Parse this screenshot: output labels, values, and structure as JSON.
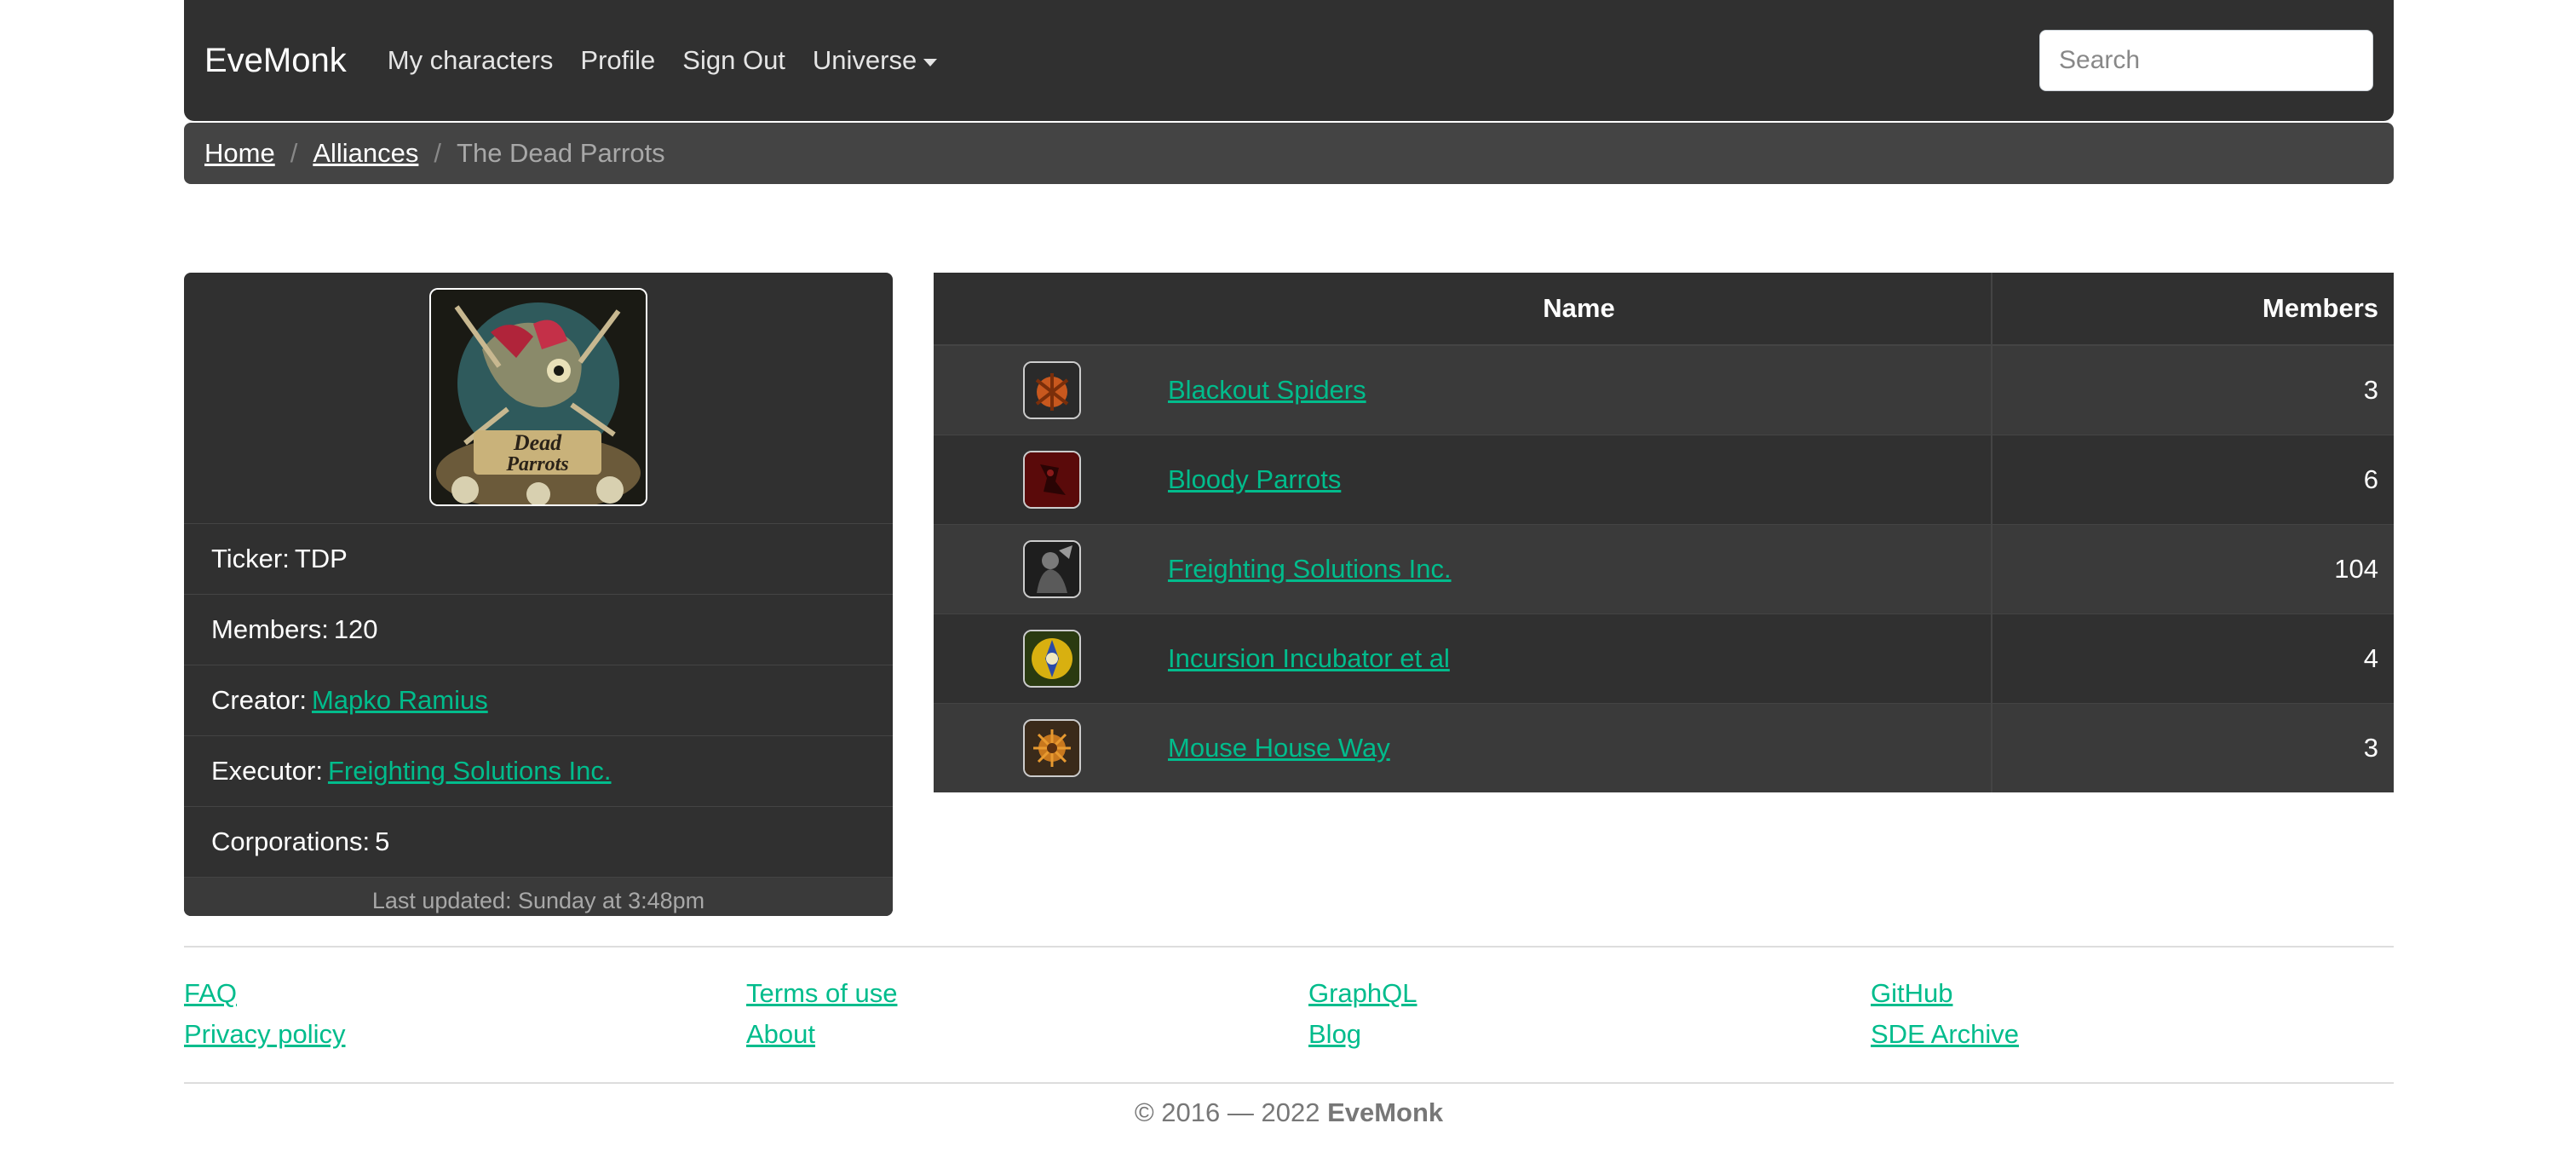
{
  "navbar": {
    "brand": "EveMonk",
    "links": [
      "My characters",
      "Profile",
      "Sign Out"
    ],
    "dropdown": "Universe",
    "search_placeholder": "Search"
  },
  "breadcrumb": {
    "home": "Home",
    "alliances": "Alliances",
    "current": "The Dead Parrots"
  },
  "alliance": {
    "ticker_label": "Ticker:",
    "ticker": "TDP",
    "members_label": "Members:",
    "members": "120",
    "creator_label": "Creator:",
    "creator": "Mapko Ramius",
    "executor_label": "Executor:",
    "executor": "Freighting Solutions Inc.",
    "corporations_label": "Corporations:",
    "corporations": "5",
    "last_updated": "Last updated: Sunday at 3:48pm"
  },
  "table": {
    "headers": {
      "name": "Name",
      "members": "Members"
    },
    "rows": [
      {
        "name": "Blackout Spiders",
        "members": "3"
      },
      {
        "name": "Bloody Parrots",
        "members": "6"
      },
      {
        "name": "Freighting Solutions Inc.",
        "members": "104"
      },
      {
        "name": "Incursion Incubator et al",
        "members": "4"
      },
      {
        "name": "Mouse House Way",
        "members": "3"
      }
    ]
  },
  "footer": {
    "faq": "FAQ",
    "privacy": "Privacy policy",
    "terms": "Terms of use",
    "about": "About",
    "graphql": "GraphQL",
    "blog": "Blog",
    "github": "GitHub",
    "sde": "SDE Archive",
    "copyright_prefix": "© 2016 — 2022",
    "copyright_brand": "EveMonk"
  },
  "colors": {
    "navbar_bg": "#303030",
    "breadcrumb_bg": "#444444",
    "link": "#00bc8c"
  }
}
